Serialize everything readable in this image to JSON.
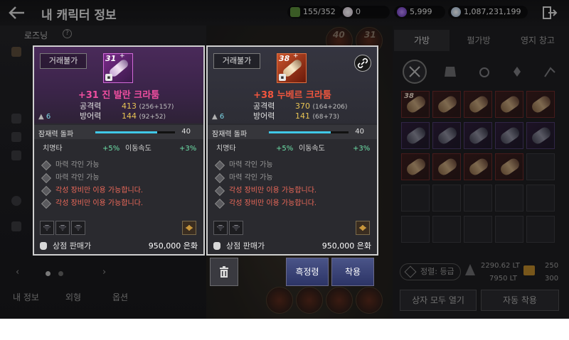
{
  "header": {
    "title": "내 캐릭터 정보",
    "currencies": [
      {
        "name": "energy",
        "value": "155/352",
        "color": "#6aa84f"
      },
      {
        "name": "pearl",
        "value": "0",
        "color": "#d8d0d0"
      },
      {
        "name": "crystal",
        "value": "5,999",
        "color": "#7a4ad8"
      },
      {
        "name": "silver",
        "value": "1,087,231,199",
        "color": "#c8d8e8"
      }
    ]
  },
  "left_panel": {
    "character_name": "로즈닝",
    "help_icon": "?",
    "tabs": [
      "내 정보",
      "외형",
      "옵션"
    ],
    "pager_prev": "‹",
    "pager_next": "›"
  },
  "background_levels": [
    "40",
    "31"
  ],
  "inventory": {
    "tabs": [
      "가방",
      "펄가방",
      "영지 창고"
    ],
    "items": [
      {
        "level": "38",
        "kind": "red"
      },
      {
        "level": "",
        "kind": "red"
      },
      {
        "level": "",
        "kind": "red"
      },
      {
        "level": "",
        "kind": "red"
      },
      {
        "level": "",
        "kind": "red"
      },
      {
        "level": "",
        "kind": "purple"
      },
      {
        "level": "",
        "kind": "purple"
      },
      {
        "level": "",
        "kind": "purple"
      },
      {
        "level": "",
        "kind": "purple"
      },
      {
        "level": "",
        "kind": "purple"
      },
      {
        "level": "",
        "kind": "red"
      },
      {
        "level": "",
        "kind": "red"
      },
      {
        "level": "",
        "kind": "red"
      },
      {
        "level": "",
        "kind": "red"
      }
    ],
    "grade_button": "정렬: 등급",
    "weight": {
      "current": "2290.62 LT",
      "max": "7950 LT",
      "slots_used": "250",
      "slots_max": "300"
    },
    "open_all_boxes": "상자 모두 열기",
    "auto_equip": "자동 착용"
  },
  "cards": [
    {
      "trade_badge": "거래불가",
      "item_level": "31",
      "enhance_plus": "+",
      "name": "+31 진 발란 크라툼",
      "attack_label": "공격력",
      "attack_value": "413",
      "attack_detail": "(256+157)",
      "defense_label": "방어력",
      "defense_value": "144",
      "defense_detail": "(92+52)",
      "weight_level": "6",
      "potential_label": "잠재력 돌파",
      "potential_value": "40",
      "potential_fill": 0.78,
      "crit_label": "치명타",
      "crit_value": "+5%",
      "move_label": "이동속도",
      "move_value": "+3%",
      "effects": [
        {
          "text": "마력 각인 가능",
          "state": "off"
        },
        {
          "text": "마력 각인 가능",
          "state": "off"
        },
        {
          "text": "각성 장비만 이용 가능합니다.",
          "state": "on"
        },
        {
          "text": "각성 장비만 이용 가능합니다.",
          "state": "on"
        }
      ],
      "gem_icons": [
        "gem-slot-icon",
        "gem-slot-icon",
        "gem-slot-icon"
      ],
      "price_label": "상점 판매가",
      "price_value": "950,000 은화"
    },
    {
      "trade_badge": "거래불가",
      "item_level": "38",
      "enhance_plus": "+",
      "name": "+38 누베르 크라툼",
      "attack_label": "공격력",
      "attack_value": "370",
      "attack_detail": "(164+206)",
      "defense_label": "방어력",
      "defense_value": "141",
      "defense_detail": "(68+73)",
      "weight_level": "6",
      "potential_label": "잠재력 돌파",
      "potential_value": "40",
      "potential_fill": 0.78,
      "crit_label": "치명타",
      "crit_value": "+5%",
      "move_label": "이동속도",
      "move_value": "+3%",
      "effects": [
        {
          "text": "마력 각인 가능",
          "state": "off"
        },
        {
          "text": "마력 각인 가능",
          "state": "off"
        },
        {
          "text": "각성 장비만 이용 가능합니다.",
          "state": "on"
        },
        {
          "text": "각성 장비만 이용 가능합니다.",
          "state": "on"
        }
      ],
      "gem_icons": [
        "gem-slot-icon",
        "gem-slot-icon"
      ],
      "price_label": "상점 판매가",
      "price_value": "950,000 은화"
    }
  ],
  "actions": {
    "black_spirit": "흑정령",
    "equip": "착용"
  },
  "colors": {
    "accent_blue": "#40c8e8",
    "item_name_left": "#f04fa0",
    "item_name_right": "#f2563e",
    "stat_gold": "#e8c454",
    "effect_red": "#ef6a5a",
    "substat_green": "#6de0a8"
  }
}
